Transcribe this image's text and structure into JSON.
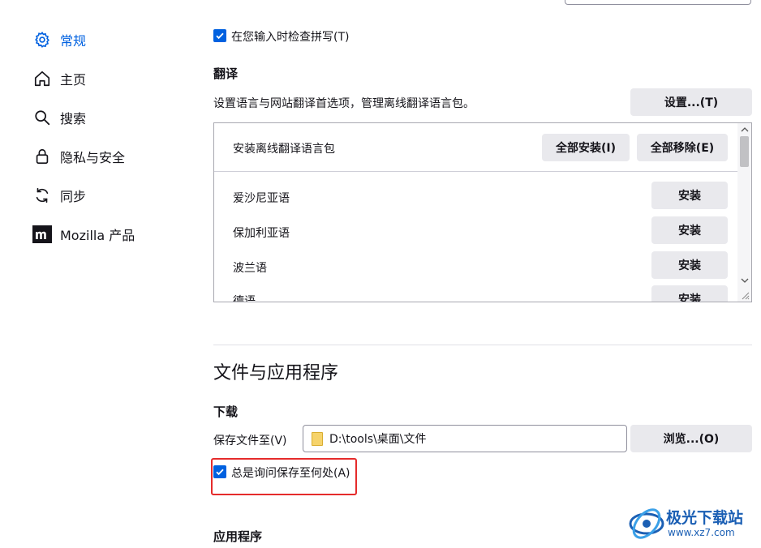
{
  "sidebar": {
    "items": [
      {
        "label": "常规",
        "icon": "gear-icon",
        "active": true
      },
      {
        "label": "主页",
        "icon": "home-icon",
        "active": false
      },
      {
        "label": "搜索",
        "icon": "search-icon",
        "active": false
      },
      {
        "label": "隐私与安全",
        "icon": "lock-icon",
        "active": false
      },
      {
        "label": "同步",
        "icon": "sync-icon",
        "active": false
      },
      {
        "label": "Mozilla 产品",
        "icon": "mozilla-logo-icon",
        "active": false
      }
    ]
  },
  "spellcheck": {
    "label": "在您输入时检查拼写(T)",
    "checked": true
  },
  "translation": {
    "heading": "翻译",
    "description": "设置语言与网站翻译首选项，管理离线翻译语言包。",
    "settings_button": "设置...(T)",
    "packs_header": "安装离线翻译语言包",
    "install_all": "全部安装(I)",
    "remove_all": "全部移除(E)",
    "languages": [
      {
        "name": "爱沙尼亚语",
        "action": "安装"
      },
      {
        "name": "保加利亚语",
        "action": "安装"
      },
      {
        "name": "波兰语",
        "action": "安装"
      },
      {
        "name": "德语",
        "action": "安装"
      }
    ]
  },
  "files_apps": {
    "section_title": "文件与应用程序",
    "downloads_heading": "下载",
    "save_to_label": "保存文件至(V)",
    "save_path": "D:\\tools\\桌面\\文件",
    "browse_button": "浏览...(O)",
    "always_ask": {
      "label": "总是询问保存至何处(A)",
      "checked": true
    },
    "apps_heading": "应用程序"
  },
  "watermark": {
    "name": "极光下载站",
    "url": "www.xz7.com"
  },
  "colors": {
    "accent": "#0061e0",
    "highlight": "#e52b2b"
  }
}
